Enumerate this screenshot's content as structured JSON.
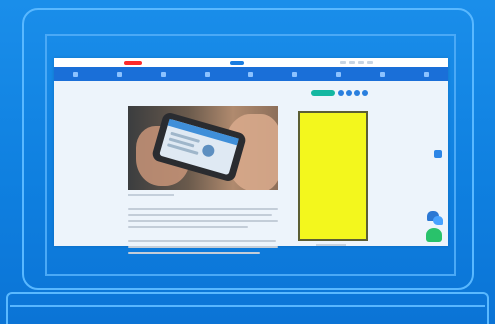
{
  "scene": {
    "device": "laptop",
    "accent_color": "#1a8eea"
  },
  "browser": {
    "header": {
      "accent_red": "#ff2a2a",
      "accent_blue": "#1b7de0",
      "nav_color": "#1a6fd8",
      "nav_item_count": 9
    },
    "article": {
      "hero_image": "person-holding-smartphone-photo",
      "body_text_lines": 8
    },
    "sidebar": {
      "ad_color": "#f3f71d",
      "toolbar_color": "#14b7a1"
    },
    "floating": {
      "chat_icon": "chat-bubbles-icon",
      "accessibility_icon": "green-tab-icon",
      "side_button_icon": "side-button-icon"
    }
  }
}
